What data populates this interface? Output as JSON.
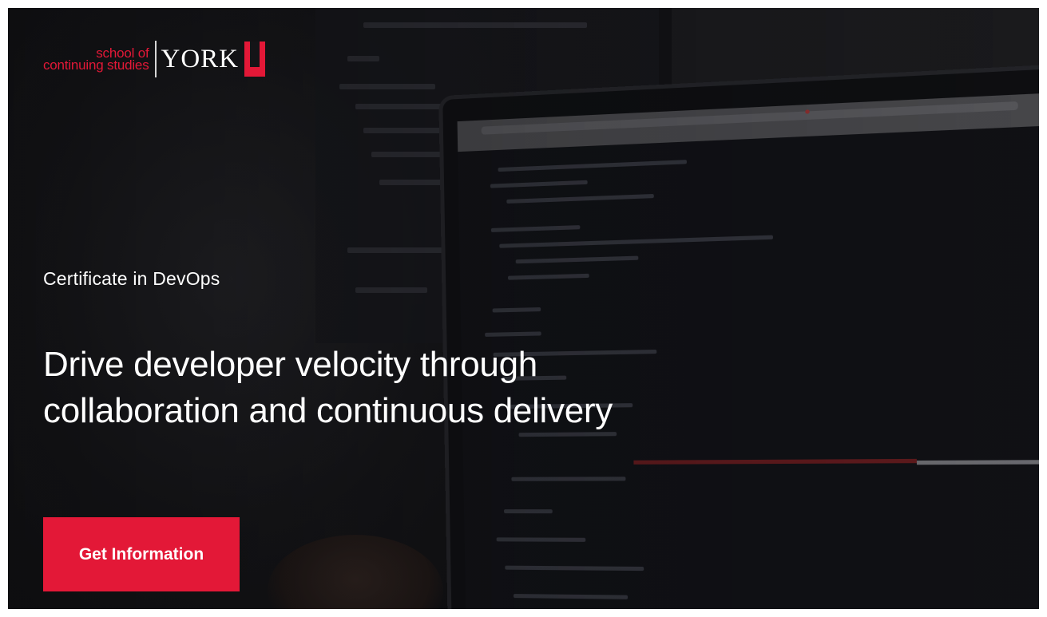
{
  "brand": {
    "school_line1": "school of",
    "school_line2": "continuing studies",
    "university": "YORK",
    "u_mark_color": "#e31837"
  },
  "hero": {
    "eyebrow": "Certificate in DevOps",
    "headline_line1": "Drive developer velocity through",
    "headline_line2": "collaboration and continuous delivery",
    "cta_label": "Get Information",
    "accent_color": "#e31837"
  }
}
